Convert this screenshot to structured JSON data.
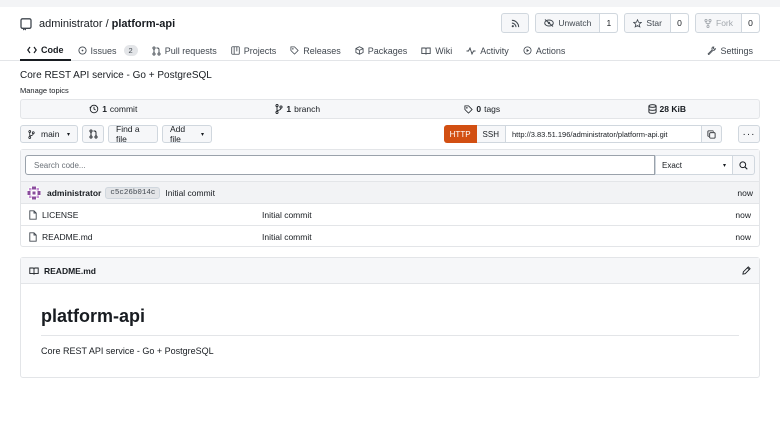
{
  "repo": {
    "owner": "administrator",
    "separator": "/",
    "name": "platform-api",
    "description": "Core REST API service - Go + PostgreSQL",
    "manage_topics": "Manage topics"
  },
  "header_actions": {
    "unwatch_label": "Unwatch",
    "watch_count": "1",
    "star_label": "Star",
    "star_count": "0",
    "fork_label": "Fork",
    "fork_count": "0"
  },
  "tabs": [
    {
      "label": "Code",
      "icon": "code-icon"
    },
    {
      "label": "Issues",
      "icon": "issue-icon",
      "badge": "2"
    },
    {
      "label": "Pull requests",
      "icon": "pull-request-icon"
    },
    {
      "label": "Projects",
      "icon": "project-icon"
    },
    {
      "label": "Releases",
      "icon": "tag-icon"
    },
    {
      "label": "Packages",
      "icon": "package-icon"
    },
    {
      "label": "Wiki",
      "icon": "book-icon"
    },
    {
      "label": "Activity",
      "icon": "pulse-icon"
    },
    {
      "label": "Actions",
      "icon": "play-icon"
    },
    {
      "label": "Settings",
      "icon": "tools-icon"
    }
  ],
  "stats": {
    "commits_num": "1",
    "commits_label": "commit",
    "branches_num": "1",
    "branches_label": "branch",
    "tags_num": "0",
    "tags_label": "tags",
    "size": "28 KiB"
  },
  "toolbar": {
    "branch": "main",
    "find_file": "Find a file",
    "add_file": "Add file",
    "http": "HTTP",
    "ssh": "SSH",
    "clone_url": "http://3.83.51.196/administrator/platform-api.git",
    "more": "···"
  },
  "search": {
    "placeholder": "Search code...",
    "mode": "Exact"
  },
  "latest_commit": {
    "author": "administrator",
    "sha": "c5c26b014c",
    "message": "Initial commit",
    "when": "now"
  },
  "files": [
    {
      "name": "LICENSE",
      "message": "Initial commit",
      "when": "now"
    },
    {
      "name": "README.md",
      "message": "Initial commit",
      "when": "now"
    }
  ],
  "readme": {
    "filename": "README.md",
    "heading": "platform-api",
    "body": "Core REST API service - Go + PostgreSQL"
  },
  "colors": {
    "accent": "#d24f12",
    "border": "#e3e5e8",
    "text": "#181c21"
  }
}
